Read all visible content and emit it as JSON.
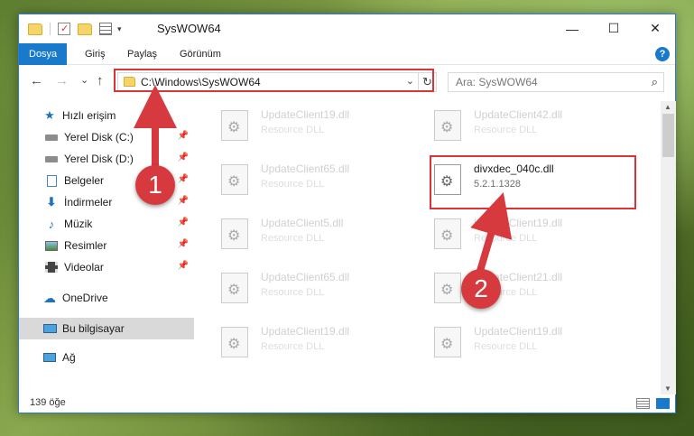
{
  "window": {
    "title": "SysWOW64",
    "minimize": "—",
    "maximize": "☐",
    "close": "✕"
  },
  "ribbon": {
    "tabs": [
      "Dosya",
      "Giriş",
      "Paylaş",
      "Görünüm"
    ],
    "help": "?"
  },
  "nav": {
    "back": "←",
    "forward": "→",
    "recent": "⌄",
    "up": "↑",
    "address": "C:\\Windows\\SysWOW64",
    "search_placeholder": "Ara: SysWOW64"
  },
  "sidebar": {
    "items": [
      {
        "label": "Hızlı erişim",
        "icon": "star-icon"
      },
      {
        "label": "Yerel Disk (C:)",
        "icon": "drive-icon"
      },
      {
        "label": "Yerel Disk (D:)",
        "icon": "drive-icon"
      },
      {
        "label": "Belgeler",
        "icon": "documents-icon"
      },
      {
        "label": "İndirmeler",
        "icon": "download-icon"
      },
      {
        "label": "Müzik",
        "icon": "music-icon"
      },
      {
        "label": "Resimler",
        "icon": "pictures-icon"
      },
      {
        "label": "Videolar",
        "icon": "videos-icon"
      },
      {
        "label": "OneDrive",
        "icon": "cloud-icon"
      },
      {
        "label": "Bu bilgisayar",
        "icon": "computer-icon"
      },
      {
        "label": "Ağ",
        "icon": "network-icon"
      }
    ]
  },
  "files": [
    {
      "name": "UpdateClient19.dll",
      "desc": "Resource DLL"
    },
    {
      "name": "UpdateClient42.dll",
      "desc": "Resource DLL"
    },
    {
      "name": "UpdateClient65.dll",
      "desc": "Resource DLL"
    },
    {
      "name": "divxdec_040c.dll",
      "desc": "5.2.1.1328"
    },
    {
      "name": "UpdateClient5.dll",
      "desc": "Resource DLL"
    },
    {
      "name": "UpdateClient19.dll",
      "desc": "Resource DLL"
    },
    {
      "name": "UpdateClient65.dll",
      "desc": "Resource DLL"
    },
    {
      "name": "UpdateClient21.dll",
      "desc": "Resource DLL"
    },
    {
      "name": "UpdateClient19.dll",
      "desc": "Resource DLL"
    },
    {
      "name": "UpdateClient19.dll",
      "desc": "Resource DLL"
    }
  ],
  "status": {
    "count": "139 öğe"
  },
  "callouts": [
    "1",
    "2"
  ],
  "colors": {
    "accent": "#1979ca",
    "highlight": "#d9343a"
  }
}
